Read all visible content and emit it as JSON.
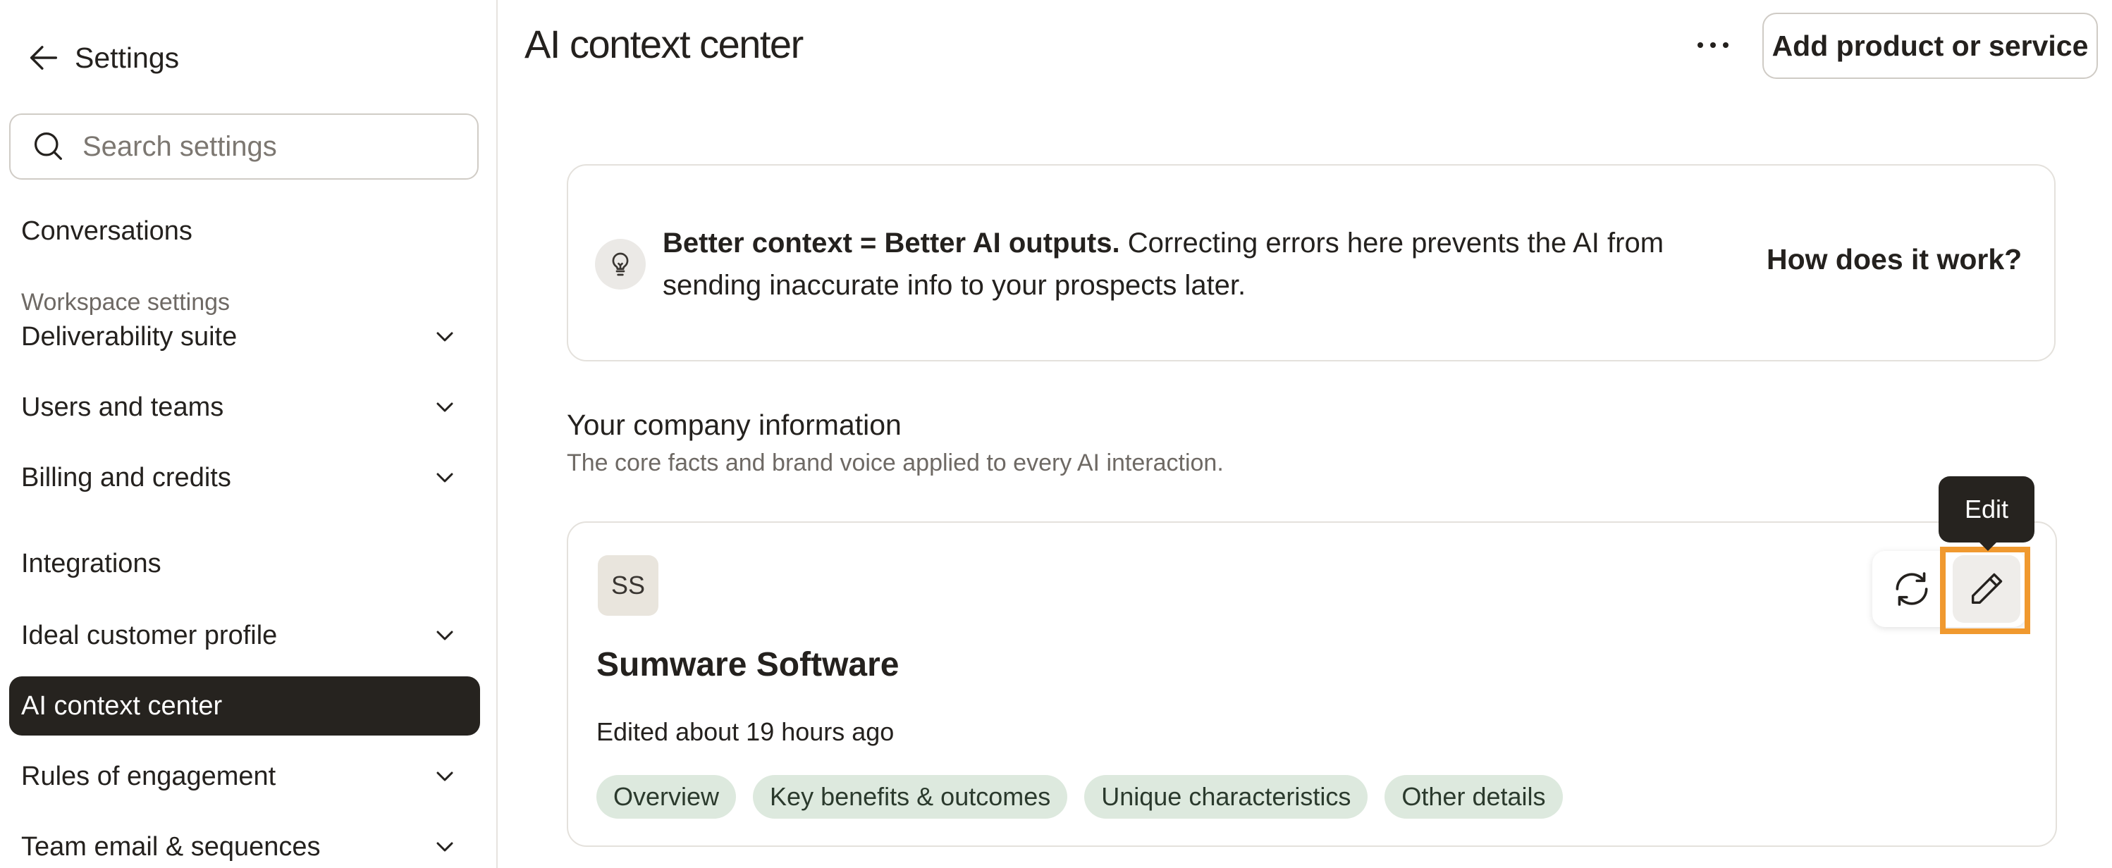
{
  "sidebar": {
    "back_label": "Settings",
    "search_placeholder": "Search settings",
    "conversations": "Conversations",
    "section_label": "Workspace settings",
    "items": [
      {
        "label": "Deliverability suite",
        "chevron": true
      },
      {
        "label": "Users and teams",
        "chevron": true
      },
      {
        "label": "Billing and credits",
        "chevron": true
      },
      {
        "label": "Integrations",
        "chevron": false
      },
      {
        "label": "Ideal customer profile",
        "chevron": true
      },
      {
        "label": "AI context center",
        "chevron": false,
        "active": true
      },
      {
        "label": "Rules of engagement",
        "chevron": true
      },
      {
        "label": "Team email & sequences",
        "chevron": true
      }
    ]
  },
  "header": {
    "title": "AI context center",
    "more_icon": "more-horizontal-icon",
    "add_button": "Add product or service"
  },
  "info_banner": {
    "icon": "lightbulb-icon",
    "bold_text": "Better context = Better AI outputs.",
    "text": " Correcting errors here prevents the AI from sending inaccurate info to your prospects later.",
    "link": "How does it work?"
  },
  "company_section": {
    "heading": "Your company information",
    "subheading": "The core facts and brand voice applied to every AI interaction."
  },
  "company_card": {
    "avatar_initials": "SS",
    "name": "Sumware Software",
    "edited": "Edited about 19 hours ago",
    "chips": [
      "Overview",
      "Key benefits & outcomes",
      "Unique characteristics",
      "Other details"
    ],
    "tooltip": "Edit"
  },
  "colors": {
    "accent_highlight": "#f0992f",
    "chip_bg": "#dde9de",
    "active_nav_bg": "#26231f"
  }
}
